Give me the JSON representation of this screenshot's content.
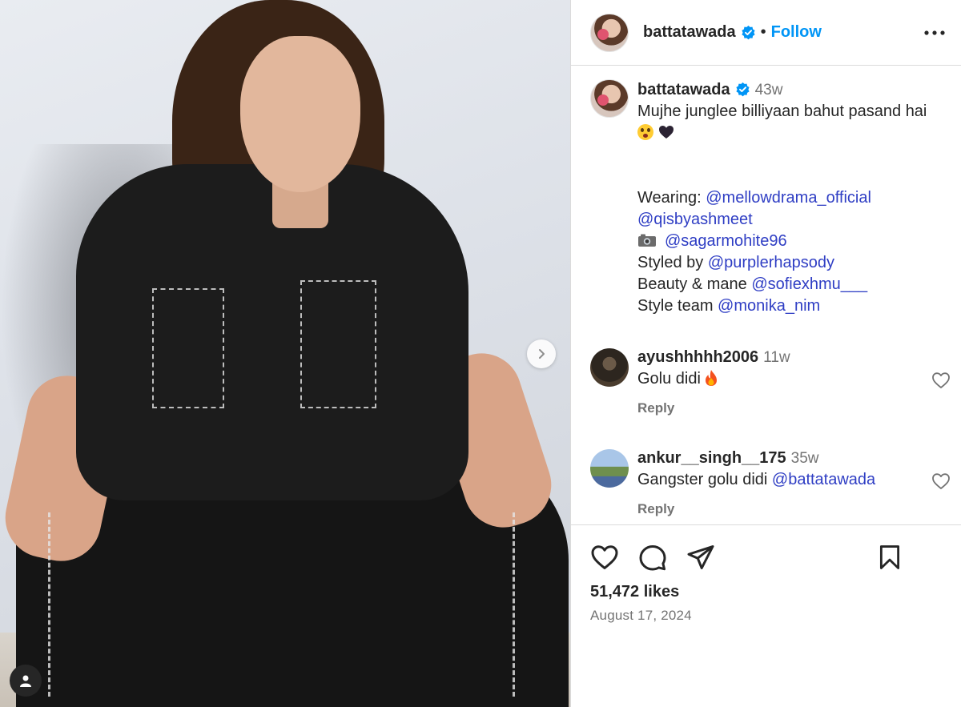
{
  "post": {
    "username": "battatawada",
    "follow_label": "Follow",
    "separator": "•",
    "caption": {
      "time": "43w",
      "text_line1": "Mujhe junglee billiyaan bahut pasand hai",
      "wearing_label": "Wearing:",
      "wearing_mention1": "@mellowdrama_official",
      "wearing_mention2": "@qisbyashmeet",
      "photo_mention": "@sagarmohite96",
      "styled_label": "Styled by",
      "styled_mention": "@purplerhapsody",
      "beauty_label": "Beauty & mane",
      "beauty_mention": "@sofiexhmu___",
      "team_label": "Style team",
      "team_mention": "@monika_nim"
    },
    "comments": [
      {
        "username": "ayushhhhh2006",
        "time": "11w",
        "text": "Golu didi",
        "reply": "Reply"
      },
      {
        "username": "ankur__singh__175",
        "time": "35w",
        "text": "Gangster golu didi",
        "mention": "@battatawada",
        "reply": "Reply"
      }
    ],
    "likes": "51,472 likes",
    "date": "August 17, 2024"
  },
  "icons": {
    "verified": "verified-badge-icon",
    "more": "more-options-icon",
    "next": "chevron-right-icon",
    "tag": "user-tag-icon",
    "like": "heart-outline-icon",
    "comment": "comment-icon",
    "share": "send-icon",
    "save": "bookmark-icon"
  },
  "colors": {
    "link_blue": "#0095f6",
    "mention": "#2f3ec4",
    "verified": "#0095f6",
    "secondary_text": "#737373",
    "border": "#dbdbdb"
  }
}
